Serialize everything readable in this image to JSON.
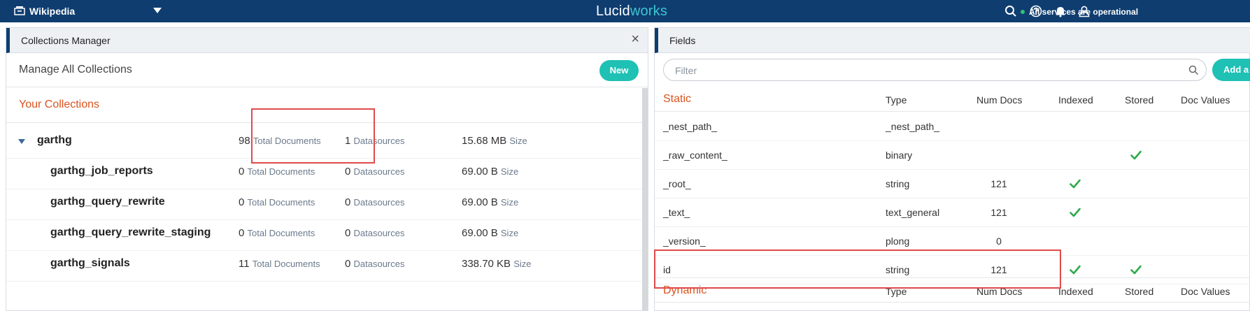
{
  "topbar": {
    "app_name": "Wikipedia",
    "brand_part1": "Lucid",
    "brand_part2": "works",
    "status": "All services are operational",
    "icons": [
      "search-icon",
      "help-icon",
      "bell-icon",
      "user-icon"
    ],
    "colors": {
      "bar": "#0f3d70",
      "brand_accent": "#3fc5cf",
      "status_ok": "#2fc178"
    }
  },
  "collections_panel": {
    "title": "Collections Manager",
    "close_label": "×",
    "manage_title": "Manage All Collections",
    "new_label": "New",
    "section_title": "Your Collections",
    "docs_unit": "Total Documents",
    "ds_unit": "Datasources",
    "size_unit": "Size",
    "rows": [
      {
        "name": "garthg",
        "docs": "98",
        "datasources": "1",
        "size": "15.68 MB",
        "expanded": true
      },
      {
        "name": "garthg_job_reports",
        "docs": "0",
        "datasources": "0",
        "size": "69.00 B"
      },
      {
        "name": "garthg_query_rewrite",
        "docs": "0",
        "datasources": "0",
        "size": "69.00 B"
      },
      {
        "name": "garthg_query_rewrite_staging",
        "docs": "0",
        "datasources": "0",
        "size": "69.00 B"
      },
      {
        "name": "garthg_signals",
        "docs": "11",
        "datasources": "0",
        "size": "338.70 KB"
      }
    ]
  },
  "fields_panel": {
    "title": "Fields",
    "filter_placeholder": "Filter",
    "add_label": "Add a Fi",
    "columns": {
      "type": "Type",
      "num_docs": "Num Docs",
      "indexed": "Indexed",
      "stored": "Stored",
      "doc_values": "Doc Values"
    },
    "static_title": "Static",
    "dynamic_title": "Dynamic",
    "rows": [
      {
        "name": "_nest_path_",
        "type": "_nest_path_",
        "num_docs": "",
        "indexed": false,
        "stored": false
      },
      {
        "name": "_raw_content_",
        "type": "binary",
        "num_docs": "",
        "indexed": false,
        "stored": true
      },
      {
        "name": "_root_",
        "type": "string",
        "num_docs": "121",
        "indexed": true,
        "stored": false
      },
      {
        "name": "_text_",
        "type": "text_general",
        "num_docs": "121",
        "indexed": true,
        "stored": false
      },
      {
        "name": "_version_",
        "type": "plong",
        "num_docs": "0",
        "indexed": false,
        "stored": false
      },
      {
        "name": "id",
        "type": "string",
        "num_docs": "121",
        "indexed": true,
        "stored": true
      }
    ],
    "check_color": "#2eaa4a"
  }
}
